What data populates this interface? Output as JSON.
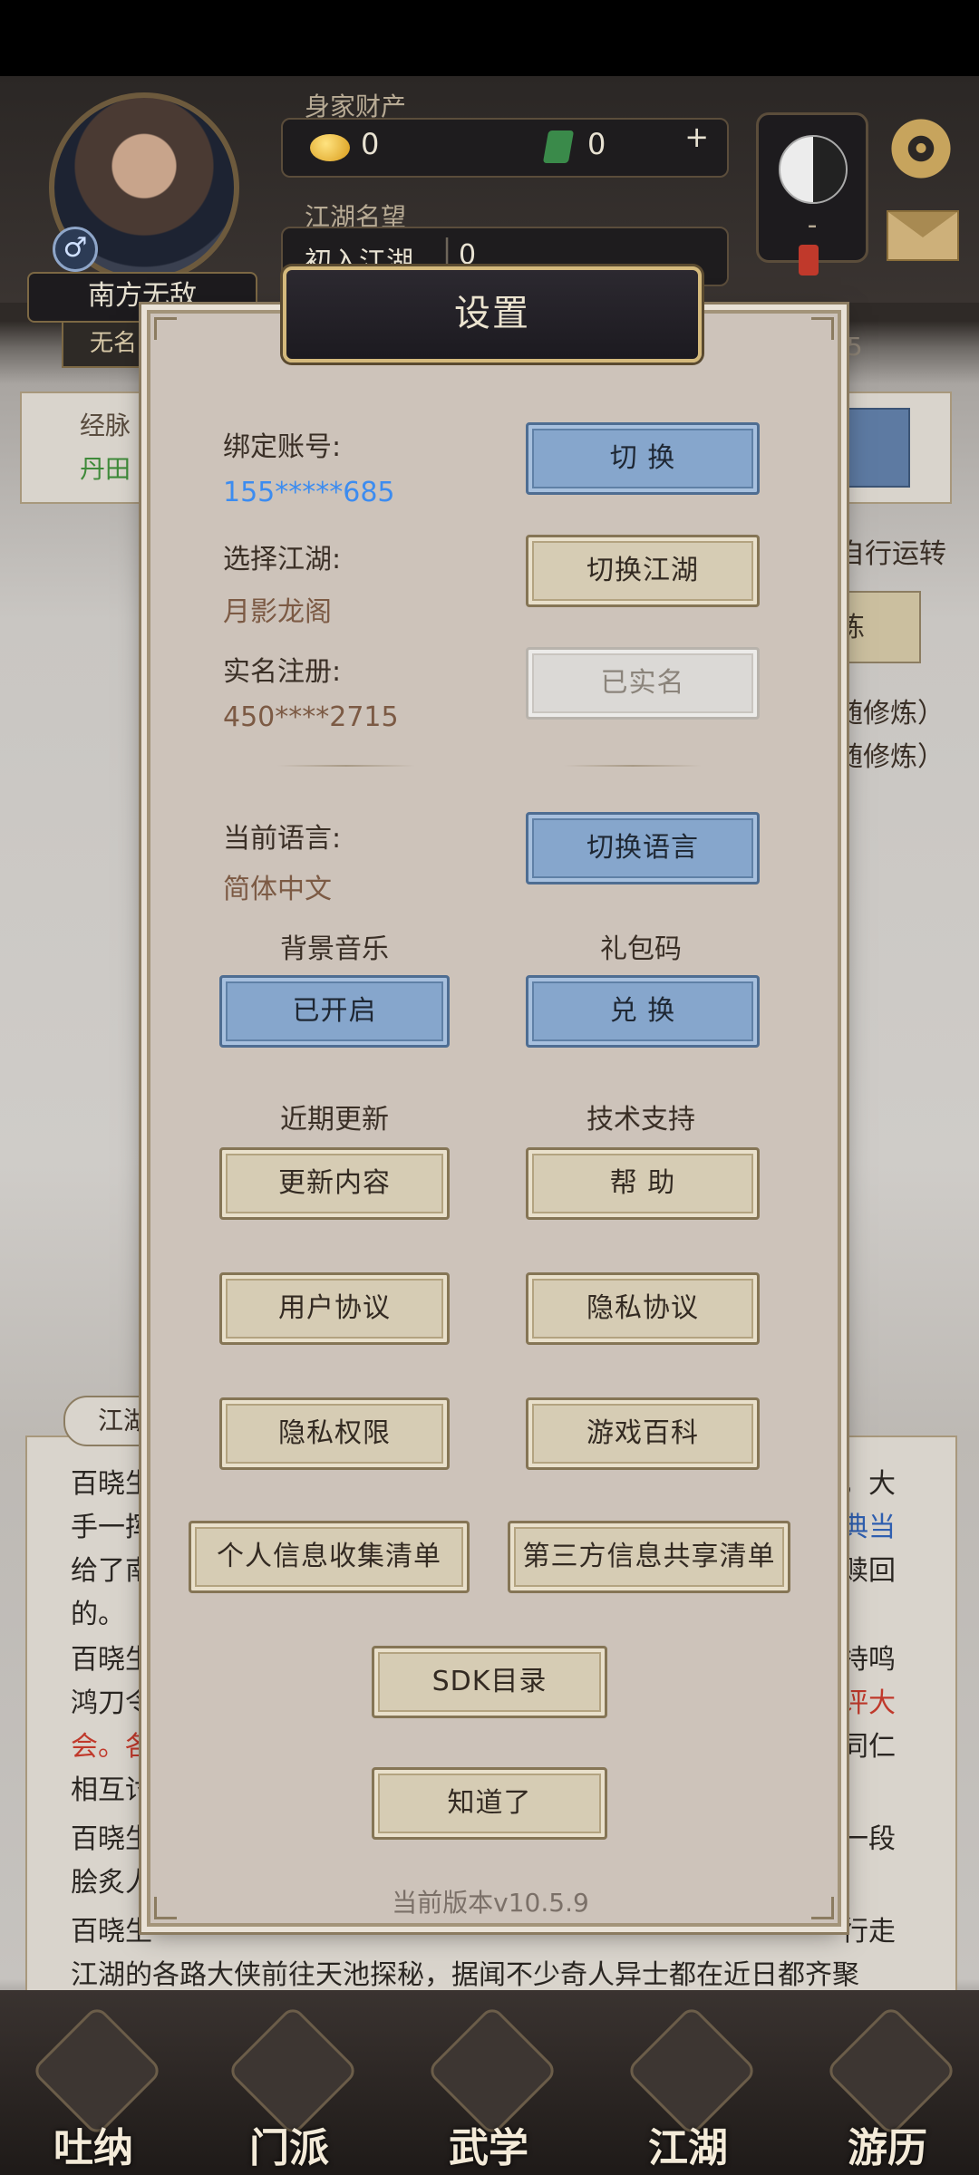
{
  "hud": {
    "wealth_label": "身家财产",
    "coins": "0",
    "jade": "0",
    "plus": "+",
    "fame_label": "江湖名望",
    "fame_rank": "初入江湖",
    "fame_value": "0",
    "player_name": "南方无敌",
    "player_title": "无名",
    "gender_symbol": "♂",
    "yin_yang_text": "-",
    "gear": "⚙",
    "partial_number": "85"
  },
  "background": {
    "meridian_label": "经脉",
    "dantian_label": "丹田",
    "auto_run": "自行运转",
    "train_btn": "炼",
    "follow1": "随修炼）",
    "follow2": "随修炼）",
    "jianghu_tab": "江湖",
    "lines": [
      "百晓生",
      "手一挥",
      "给了南",
      "的。",
      "百晓生",
      "鸿刀令",
      "会。各",
      "相互讨",
      "百晓生",
      "脍炙人",
      "百晓生",
      "江湖的各路大侠前往天池探秘，据闻不少奇人异士都在近日都齐聚"
    ],
    "right_lines": [
      "，大",
      "典当",
      "赎回",
      "持鸣",
      "评大",
      "同仁",
      "一段",
      "行走"
    ]
  },
  "dialog": {
    "title": "设置",
    "account_label": "绑定账号:",
    "account_value": "155*****685",
    "switch_btn": "切 换",
    "server_label": "选择江湖:",
    "server_value": "月影龙阁",
    "switch_server_btn": "切换江湖",
    "realname_label": "实名注册:",
    "realname_value": "450****2715",
    "realname_btn": "已实名",
    "language_label": "当前语言:",
    "language_value": "简体中文",
    "switch_language_btn": "切换语言",
    "bgm_label": "背景音乐",
    "bgm_btn": "已开启",
    "gift_label": "礼包码",
    "redeem_btn": "兑 换",
    "updates_label": "近期更新",
    "updates_btn": "更新内容",
    "support_label": "技术支持",
    "help_btn": "帮 助",
    "user_agreement_btn": "用户协议",
    "privacy_agreement_btn": "隐私协议",
    "privacy_permission_btn": "隐私权限",
    "wiki_btn": "游戏百科",
    "personal_info_btn": "个人信息收集清单",
    "third_party_btn": "第三方信息共享清单",
    "sdk_btn": "SDK目录",
    "ok_btn": "知道了",
    "version": "当前版本v10.5.9"
  },
  "nav": {
    "items": [
      "吐纳",
      "门派",
      "武学",
      "江湖",
      "游历"
    ]
  },
  "colors": {
    "dialog_bg": "#cdc3ba",
    "blue_button": "#86a6cc",
    "tan_button": "#d6ccb4",
    "grey_button": "#dbd9d6",
    "link_blue": "#3c8cf0"
  }
}
